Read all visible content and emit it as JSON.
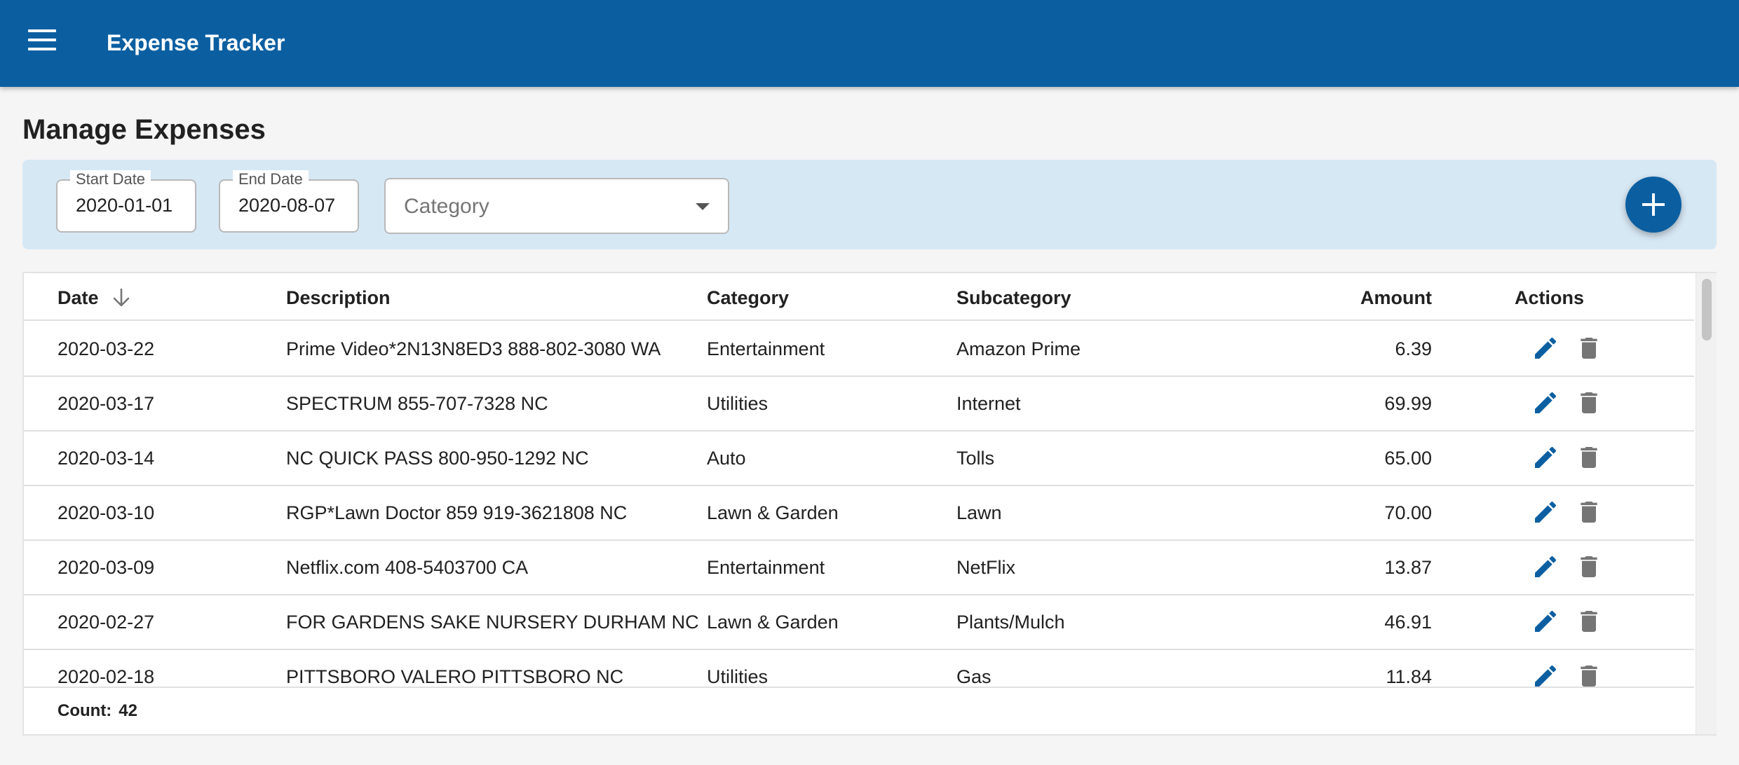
{
  "app": {
    "title": "Expense Tracker"
  },
  "page": {
    "title": "Manage Expenses"
  },
  "filters": {
    "start_date": {
      "label": "Start Date",
      "value": "2020-01-01"
    },
    "end_date": {
      "label": "End Date",
      "value": "2020-08-07"
    },
    "category": {
      "placeholder": "Category",
      "value": ""
    }
  },
  "table": {
    "columns": {
      "date": "Date",
      "description": "Description",
      "category": "Category",
      "subcategory": "Subcategory",
      "amount": "Amount",
      "actions": "Actions"
    },
    "sort": {
      "column": "date",
      "direction": "descending"
    },
    "rows": [
      {
        "date": "2020-03-22",
        "description": "Prime Video*2N13N8ED3 888-802-3080 WA",
        "category": "Entertainment",
        "subcategory": "Amazon Prime",
        "amount": "6.39"
      },
      {
        "date": "2020-03-17",
        "description": "SPECTRUM 855-707-7328 NC",
        "category": "Utilities",
        "subcategory": "Internet",
        "amount": "69.99"
      },
      {
        "date": "2020-03-14",
        "description": "NC QUICK PASS 800-950-1292 NC",
        "category": "Auto",
        "subcategory": "Tolls",
        "amount": "65.00"
      },
      {
        "date": "2020-03-10",
        "description": "RGP*Lawn Doctor 859 919-3621808 NC",
        "category": "Lawn & Garden",
        "subcategory": "Lawn",
        "amount": "70.00"
      },
      {
        "date": "2020-03-09",
        "description": "Netflix.com 408-5403700 CA",
        "category": "Entertainment",
        "subcategory": "NetFlix",
        "amount": "13.87"
      },
      {
        "date": "2020-02-27",
        "description": "FOR GARDENS SAKE NURSERY DURHAM NC",
        "category": "Lawn & Garden",
        "subcategory": "Plants/Mulch",
        "amount": "46.91"
      },
      {
        "date": "2020-02-18",
        "description": "PITTSBORO VALERO PITTSBORO NC",
        "category": "Utilities",
        "subcategory": "Gas",
        "amount": "11.84"
      }
    ],
    "footer": {
      "count_label": "Count:",
      "count": "42"
    }
  },
  "icons": {
    "menu": "menu-icon",
    "add": "plus-icon",
    "sort": "arrow-down-icon",
    "edit": "pencil-icon",
    "delete": "trash-icon",
    "dropdown": "caret-down-icon"
  },
  "colors": {
    "primary": "#0b5fa1",
    "filter_background": "#d7e8f5",
    "delete_icon": "#757575"
  }
}
